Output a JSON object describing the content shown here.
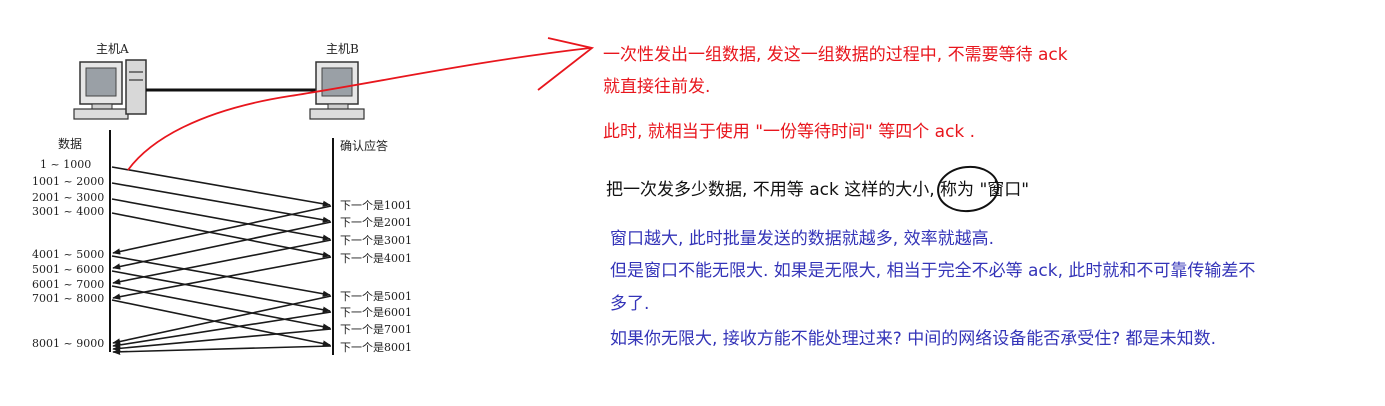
{
  "diagram": {
    "host_a_label": "主机A",
    "host_b_label": "主机B",
    "data_header": "数据",
    "ack_header": "确认应答",
    "data_rows": [
      "1 ~ 1000",
      "1001 ~ 2000",
      "2001 ~ 3000",
      "3001 ~ 4000",
      "4001 ~ 5000",
      "5001 ~ 6000",
      "6001 ~ 7000",
      "7001 ~ 8000",
      "8001 ~ 9000"
    ],
    "ack_rows": [
      "下一个是1001",
      "下一个是2001",
      "下一个是3001",
      "下一个是4001",
      "下一个是5001",
      "下一个是6001",
      "下一个是7001",
      "下一个是8001"
    ]
  },
  "notes": {
    "red_line1": "一次性发出一组数据, 发这一组数据的过程中, 不需要等待 ack",
    "red_line2": "就直接往前发.",
    "red_line3": "此时, 就相当于使用 \"一份等待时间\" 等四个 ack .",
    "black_pre": "把一次发多少数据, 不用等 ack 这样的",
    "black_circled": "大小",
    "black_post": ", 称为 \"窗口\"",
    "blue_line1": "窗口越大, 此时批量发送的数据就越多, 效率就越高.",
    "blue_line2": "但是窗口不能无限大. 如果是无限大, 相当于完全不必等 ack, 此时就和不可靠传输差不",
    "blue_line3": "多了.",
    "blue_line4": "如果你无限大, 接收方能不能处理过来? 中间的网络设备能否承受住? 都是未知数."
  },
  "colors": {
    "red": "#e8161d",
    "black": "#111111",
    "blue": "#3434b8",
    "arrow": "#1a1a1a"
  }
}
